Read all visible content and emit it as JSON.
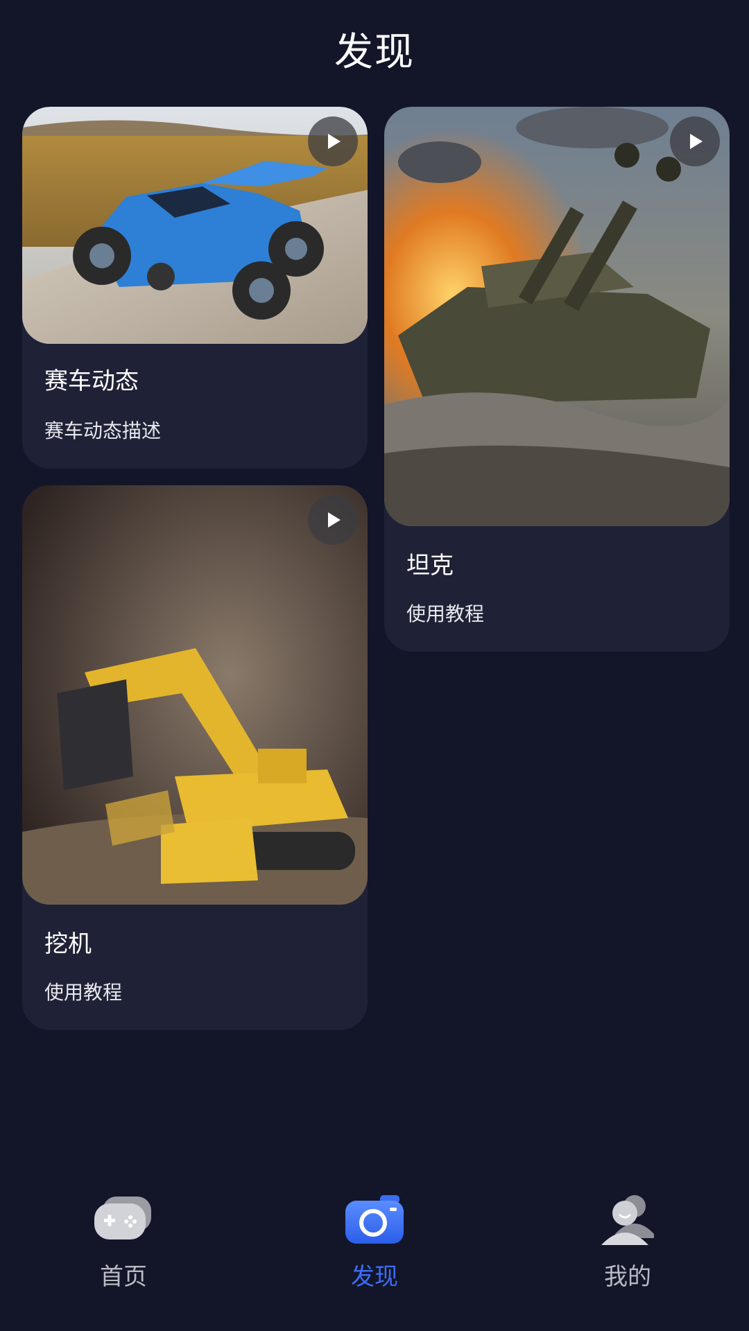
{
  "header": {
    "title": "发现"
  },
  "cards": [
    {
      "title": "赛车动态",
      "description": "赛车动态描述",
      "image_icon": "rc-race-car-photo",
      "play_icon": "play-icon"
    },
    {
      "title": "坦克",
      "description": "使用教程",
      "image_icon": "tank-battle-photo",
      "play_icon": "play-icon"
    },
    {
      "title": "挖机",
      "description": "使用教程",
      "image_icon": "toy-excavator-photo",
      "play_icon": "play-icon"
    }
  ],
  "bottom_nav": {
    "items": [
      {
        "label": "首页",
        "icon": "gamepad-icon",
        "active": false
      },
      {
        "label": "发现",
        "icon": "camera-icon",
        "active": true
      },
      {
        "label": "我的",
        "icon": "user-icon",
        "active": false
      }
    ]
  },
  "colors": {
    "background": "#131629",
    "card": "#1f2236",
    "active_accent": "#3d6cf5",
    "inactive_label": "#b9bac3"
  }
}
